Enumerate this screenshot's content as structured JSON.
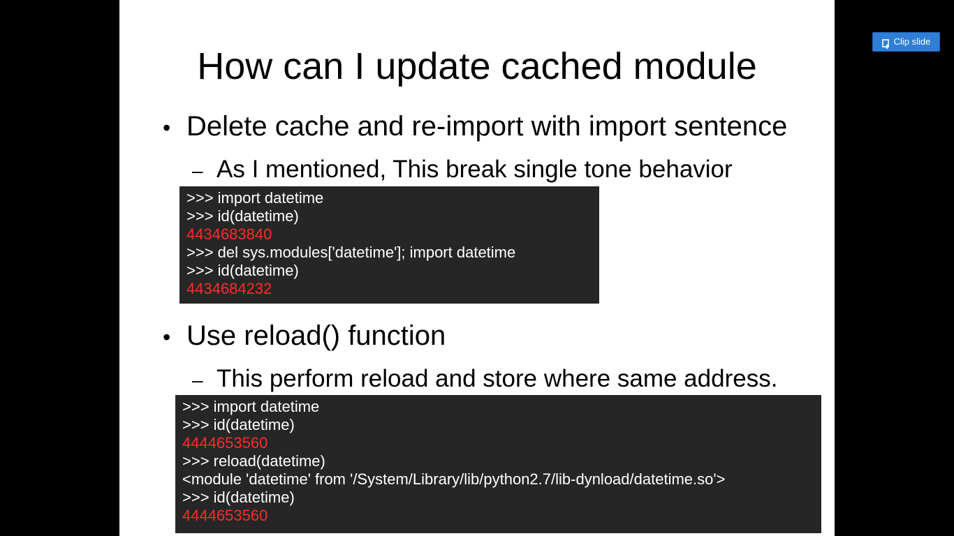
{
  "viewer": {
    "clip_button_label": "Clip slide"
  },
  "slide": {
    "title": "How can I update cached module",
    "bullets": [
      {
        "text": "Delete cache and re-import with import sentence",
        "sub": "As I mentioned, This break single tone behavior",
        "code": [
          {
            "text": ">>> import datetime",
            "type": "in"
          },
          {
            "text": ">>> id(datetime)",
            "type": "in"
          },
          {
            "text": "4434683840",
            "type": "out"
          },
          {
            "text": ">>> del sys.modules['datetime']; import datetime",
            "type": "in"
          },
          {
            "text": ">>> id(datetime)",
            "type": "in"
          },
          {
            "text": "4434684232",
            "type": "out"
          }
        ]
      },
      {
        "text": "Use reload() function",
        "sub": "This perform reload and store where same address.",
        "code": [
          {
            "text": ">>> import datetime",
            "type": "in"
          },
          {
            "text": ">>> id(datetime)",
            "type": "in"
          },
          {
            "text": "4444653560",
            "type": "out"
          },
          {
            "text": ">>> reload(datetime)",
            "type": "in"
          },
          {
            "text": "<module 'datetime' from '/System/Library/lib/python2.7/lib-dynload/datetime.so'>",
            "type": "in"
          },
          {
            "text": ">>> id(datetime)",
            "type": "in"
          },
          {
            "text": "4444653560",
            "type": "out"
          }
        ]
      }
    ]
  },
  "colors": {
    "output_text": "#ff2b2b",
    "code_background": "#262626",
    "button_accent": "#2f7fd6"
  },
  "icons": {
    "clip": "clip-slide-icon"
  }
}
